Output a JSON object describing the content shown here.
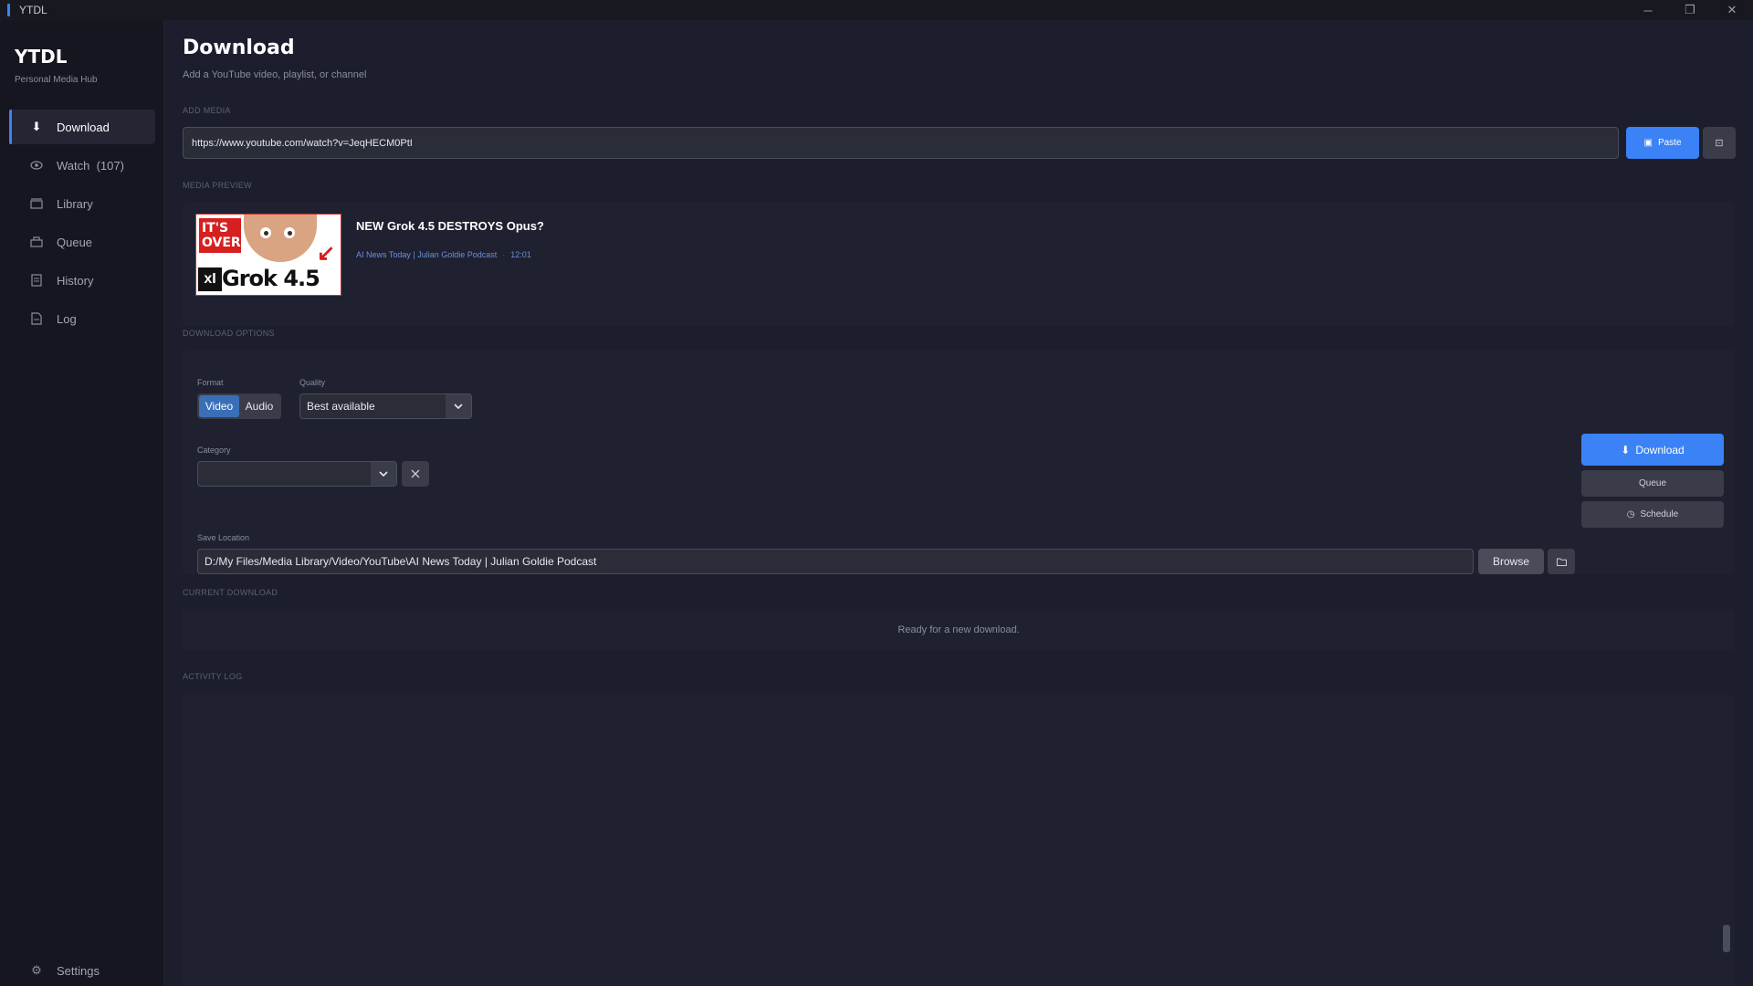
{
  "window": {
    "title": "YTDL",
    "controls": [
      "─",
      "❐",
      "✕"
    ]
  },
  "sidebar": {
    "brand": "YTDL",
    "tagline": "Personal Media Hub",
    "items": [
      {
        "label": "Download",
        "icon": "download-icon",
        "active": true
      },
      {
        "label": "Watch  (107)",
        "icon": "eye-icon",
        "active": false
      },
      {
        "label": "Library",
        "icon": "library-icon",
        "active": false
      },
      {
        "label": "Queue",
        "icon": "queue-icon",
        "active": false
      },
      {
        "label": "History",
        "icon": "history-icon",
        "active": false
      },
      {
        "label": "Log",
        "icon": "log-icon",
        "active": false
      }
    ],
    "settings_label": "Settings"
  },
  "header": {
    "title": "Download",
    "subtitle": "Add a YouTube video, playlist, or channel"
  },
  "add_media": {
    "label": "ADD MEDIA",
    "url_value": "https://www.youtube.com/watch?v=JeqHECM0PtI",
    "paste_label": "Paste"
  },
  "media_preview": {
    "label": "MEDIA PREVIEW",
    "title": "NEW Grok 4.5 DESTROYS Opus?",
    "channel": "AI News Today | Julian Goldie Podcast",
    "duration": "12:01",
    "thumbnail": {
      "badge": "IT'S OVER!",
      "logo": "xI",
      "caption": "Grok 4.5"
    }
  },
  "download_options": {
    "label": "DOWNLOAD OPTIONS",
    "format_label": "Format",
    "formats": [
      "Video",
      "Audio"
    ],
    "selected_format": "Video",
    "quality_label": "Quality",
    "quality_value": "Best available",
    "category_label": "Category",
    "category_value": "",
    "save_location_label": "Save Location",
    "save_location_value": "D:/My Files/Media Library/Video/YouTube\\AI News Today | Julian Goldie Podcast",
    "browse_label": "Browse",
    "download_label": "Download",
    "queue_label": "Queue",
    "schedule_label": "Schedule"
  },
  "current_download": {
    "label": "CURRENT DOWNLOAD",
    "status": "Ready for a new download."
  },
  "activity_log": {
    "label": "ACTIVITY LOG"
  },
  "colors": {
    "accent": "#3b82f6",
    "background": "#1c1e2e",
    "sidebar": "#15161f",
    "panel": "#1f2131"
  }
}
